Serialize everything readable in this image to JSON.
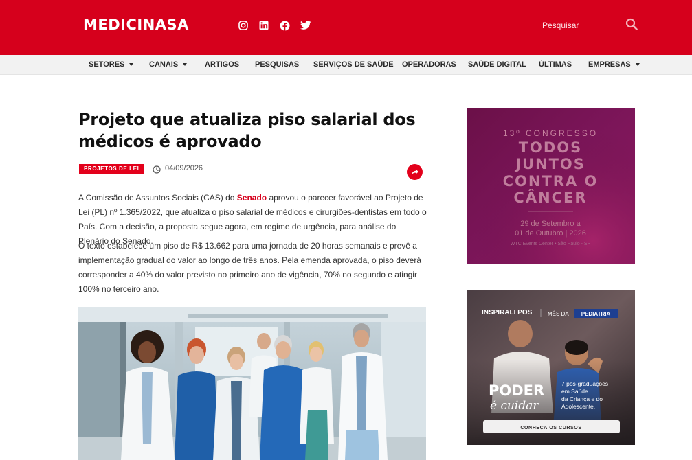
{
  "header": {
    "logo": "MEDICINASA",
    "search_placeholder": "Pesquisar",
    "social_icons": [
      "instagram-icon",
      "linkedin-icon",
      "facebook-icon",
      "twitter-icon"
    ],
    "brand_color": "#d6001c"
  },
  "nav": {
    "items": [
      {
        "label": "SETORES",
        "dropdown": true
      },
      {
        "label": "CANAIS",
        "dropdown": true
      },
      {
        "label": "ARTIGOS",
        "dropdown": false
      },
      {
        "label": "PESQUISAS",
        "dropdown": false
      },
      {
        "label": "SERVIÇOS DE SAÚDE",
        "dropdown": false
      },
      {
        "label": "OPERADORAS",
        "dropdown": false
      },
      {
        "label": "SAÚDE DIGITAL",
        "dropdown": false
      },
      {
        "label": "ÚLTIMAS",
        "dropdown": false
      },
      {
        "label": "EMPRESAS",
        "dropdown": true
      }
    ]
  },
  "article": {
    "title": "Projeto que atualiza piso salarial dos médicos é aprovado",
    "tag": "PROJETOS DE LEI",
    "date": "04/09/2026",
    "p1_before": "A Comissão de Assuntos Sociais (CAS) do ",
    "p1_link": "Senado",
    "p1_after": " aprovou o parecer favorável ao Projeto de Lei (PL) nº 1.365/2022, que atualiza o piso salarial de médicos e cirurgiões-dentistas em todo o País. Com a decisão, a proposta segue agora, em regime de urgência, para análise do Plenário do Senado.",
    "p2": "O texto estabelece um piso de R$ 13.662 para uma jornada de 20 horas semanais e prevê a implementação gradual do valor ao longo de três anos. Pela emenda aprovada, o piso deverá corresponder a 40% do valor previsto no primeiro ano de vigência, 70% no segundo e atingir 100% no terceiro ano."
  },
  "ad1": {
    "line1": "13º CONGRESSO",
    "line2": "TODOS",
    "line3": "JUNTOS",
    "line4": "CONTRA O",
    "line5": "CÂNCER",
    "date1": "29 de Setembro a",
    "date2": "01 de Outubro | 2026",
    "venue": "WTC Events Center • São Paulo - SP"
  },
  "ad2": {
    "brand": "INSPIRALI POS",
    "month_label": "MÊS DA",
    "month_badge": "PEDIATRIA",
    "headline1": "PODER",
    "headline2": "é cuidar",
    "desc1": "7 pós-graduações",
    "desc2": "em Saúde",
    "desc3": "da Criança e do",
    "desc4": "Adolescente.",
    "cta": "CONHEÇA OS CURSOS"
  }
}
